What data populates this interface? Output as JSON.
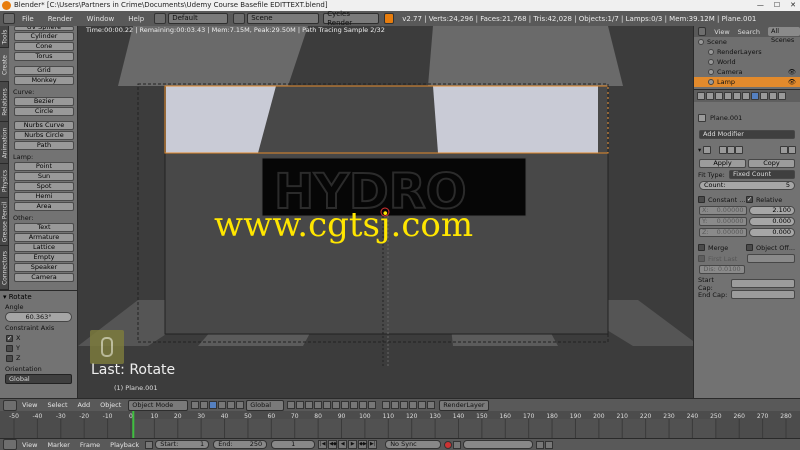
{
  "window": {
    "title": "Blender* [C:\\Users\\Partners in Crime\\Documents\\Udemy  Course  Basefile EDITTEXT.blend]",
    "minimize": "—",
    "maximize": "☐",
    "close": "✕"
  },
  "infobar": {
    "menus": [
      "File",
      "Render",
      "Window",
      "Help"
    ],
    "screen_layout": "Default",
    "scene": "Scene",
    "render_engine": "Cycles Render",
    "stats": "v2.77 | Verts:24,296 | Faces:21,768 | Tris:42,028 | Objects:1/7 | Lamps:0/3 | Mem:39.12M | Plane.001"
  },
  "vertical_tabs": [
    "Tools",
    "Create",
    "Relations",
    "Animation",
    "Physics",
    "Grease Pencil",
    "Connectors"
  ],
  "toolshelf": {
    "mesh_items": [
      "UV Sphere",
      "Cylinder",
      "Cone",
      "Torus"
    ],
    "misc_items": [
      "Grid",
      "Monkey"
    ],
    "curve_label": "Curve:",
    "curve_items": [
      "Bezier",
      "Circle"
    ],
    "nurbs_items": [
      "Nurbs Curve",
      "Nurbs Circle",
      "Path"
    ],
    "lamp_label": "Lamp:",
    "lamp_items": [
      "Point",
      "Sun",
      "Spot",
      "Hemi",
      "Area"
    ],
    "other_label": "Other:",
    "other_items": [
      "Text",
      "Armature",
      "Lattice",
      "Empty",
      "Speaker",
      "Camera"
    ]
  },
  "operator_panel": {
    "title": "Rotate",
    "angle_label": "Angle",
    "angle_value": "60.363°",
    "constraint_label": "Constraint Axis",
    "axes": [
      {
        "label": "X",
        "checked": true
      },
      {
        "label": "Y",
        "checked": false
      },
      {
        "label": "Z",
        "checked": false
      }
    ],
    "orientation_label": "Orientation",
    "orientation_value": "Global"
  },
  "viewport": {
    "status": "Time:00:00.22 | Remaining:00:03.43 | Mem:7.15M, Peak:29.50M | Path Tracing Sample 2/32",
    "watermark": "www.cgtsj.com",
    "last_operator": "Last: Rotate",
    "object_label": "(1) Plane.001"
  },
  "outliner": {
    "view_label": "View",
    "search_label": "Search",
    "filter_label": "All Scenes",
    "rows": [
      {
        "label": "Scene",
        "selected": false,
        "indent": 0
      },
      {
        "label": "RenderLayers",
        "selected": false,
        "indent": 1
      },
      {
        "label": "World",
        "selected": false,
        "indent": 1
      },
      {
        "label": "Camera",
        "selected": false,
        "indent": 1
      },
      {
        "label": "Lamp",
        "selected": true,
        "indent": 1
      }
    ]
  },
  "properties": {
    "object_path": "Plane.001",
    "add_modifier": "Add Modifier",
    "apply": "Apply",
    "copy": "Copy",
    "fit_type_label": "Fit Type:",
    "fit_type_value": "Fixed Count",
    "count_label": "Count:",
    "count_value": "5",
    "constant_label": "Constant ...",
    "relative_label": "Relative",
    "constant_rows": [
      {
        "const_axis": "X:",
        "const_val": "0.00000",
        "rel_val": "2.100"
      },
      {
        "const_axis": "Y:",
        "const_val": "0.00000",
        "rel_val": "0.000"
      },
      {
        "const_axis": "Z:",
        "const_val": "0.00000",
        "rel_val": "0.000"
      }
    ],
    "merge_label": "Merge",
    "object_offset_label": "Object Off...",
    "first_last_label": "First Last",
    "distance_label": "Dis: 0.0100",
    "start_cap_label": "Start Cap:",
    "end_cap_label": "End Cap:"
  },
  "view3d_header": {
    "menus": [
      "View",
      "Select",
      "Add",
      "Object"
    ],
    "mode": "Object Mode",
    "orientation": "Global",
    "render_layer": "RenderLayer"
  },
  "timeline": {
    "current_frame": 1,
    "ticks": [
      -50,
      -40,
      -30,
      -20,
      -10,
      0,
      10,
      20,
      30,
      40,
      50,
      60,
      70,
      80,
      90,
      100,
      110,
      120,
      130,
      140,
      150,
      160,
      170,
      180,
      190,
      200,
      210,
      220,
      230,
      240,
      250,
      260,
      270,
      280
    ]
  },
  "bottombar": {
    "menus": [
      "View",
      "Marker",
      "Frame",
      "Playback"
    ],
    "start_label": "Start:",
    "start_value": "1",
    "end_label": "End:",
    "end_value": "250",
    "current_value": "1",
    "sync": "No Sync"
  },
  "colors": {
    "accent_orange": "#e28a2c",
    "selection_blue": "#5580c0",
    "watermark_yellow": "#ffe600",
    "timeline_cursor": "#3fbf3f"
  }
}
